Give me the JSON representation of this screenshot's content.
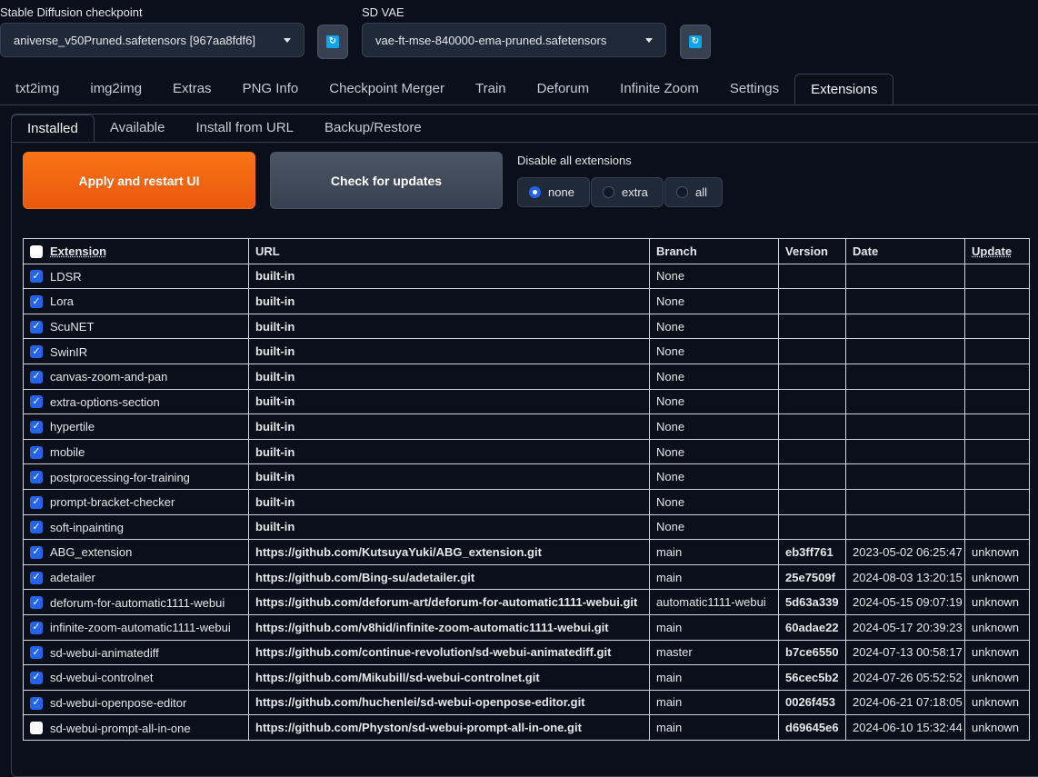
{
  "checkpoint": {
    "label": "Stable Diffusion checkpoint",
    "value": "aniverse_v50Pruned.safetensors [967aa8fdf6]"
  },
  "vae": {
    "label": "SD VAE",
    "value": "vae-ft-mse-840000-ema-pruned.safetensors"
  },
  "main_tabs": [
    "txt2img",
    "img2img",
    "Extras",
    "PNG Info",
    "Checkpoint Merger",
    "Train",
    "Deforum",
    "Infinite Zoom",
    "Settings",
    "Extensions"
  ],
  "sub_tabs": [
    "Installed",
    "Available",
    "Install from URL",
    "Backup/Restore"
  ],
  "buttons": {
    "apply": "Apply and restart UI",
    "check": "Check for updates"
  },
  "disable": {
    "label": "Disable all extensions",
    "options": [
      "none",
      "extra",
      "all"
    ],
    "selected": "none"
  },
  "table": {
    "headers": [
      "Extension",
      "URL",
      "Branch",
      "Version",
      "Date",
      "Update"
    ],
    "rows": [
      {
        "enabled": true,
        "name": "LDSR",
        "url": "built-in",
        "branch": "None",
        "version": "",
        "date": "",
        "update": ""
      },
      {
        "enabled": true,
        "name": "Lora",
        "url": "built-in",
        "branch": "None",
        "version": "",
        "date": "",
        "update": ""
      },
      {
        "enabled": true,
        "name": "ScuNET",
        "url": "built-in",
        "branch": "None",
        "version": "",
        "date": "",
        "update": ""
      },
      {
        "enabled": true,
        "name": "SwinIR",
        "url": "built-in",
        "branch": "None",
        "version": "",
        "date": "",
        "update": ""
      },
      {
        "enabled": true,
        "name": "canvas-zoom-and-pan",
        "url": "built-in",
        "branch": "None",
        "version": "",
        "date": "",
        "update": ""
      },
      {
        "enabled": true,
        "name": "extra-options-section",
        "url": "built-in",
        "branch": "None",
        "version": "",
        "date": "",
        "update": ""
      },
      {
        "enabled": true,
        "name": "hypertile",
        "url": "built-in",
        "branch": "None",
        "version": "",
        "date": "",
        "update": ""
      },
      {
        "enabled": true,
        "name": "mobile",
        "url": "built-in",
        "branch": "None",
        "version": "",
        "date": "",
        "update": ""
      },
      {
        "enabled": true,
        "name": "postprocessing-for-training",
        "url": "built-in",
        "branch": "None",
        "version": "",
        "date": "",
        "update": ""
      },
      {
        "enabled": true,
        "name": "prompt-bracket-checker",
        "url": "built-in",
        "branch": "None",
        "version": "",
        "date": "",
        "update": ""
      },
      {
        "enabled": true,
        "name": "soft-inpainting",
        "url": "built-in",
        "branch": "None",
        "version": "",
        "date": "",
        "update": ""
      },
      {
        "enabled": true,
        "name": "ABG_extension",
        "url": "https://github.com/KutsuyaYuki/ABG_extension.git",
        "branch": "main",
        "version": "eb3ff761",
        "date": "2023-05-02 06:25:47",
        "update": "unknown"
      },
      {
        "enabled": true,
        "name": "adetailer",
        "url": "https://github.com/Bing-su/adetailer.git",
        "branch": "main",
        "version": "25e7509f",
        "date": "2024-08-03 13:20:15",
        "update": "unknown"
      },
      {
        "enabled": true,
        "name": "deforum-for-automatic1111-webui",
        "url": "https://github.com/deforum-art/deforum-for-automatic1111-webui.git",
        "branch": "automatic1111-webui",
        "version": "5d63a339",
        "date": "2024-05-15 09:07:19",
        "update": "unknown"
      },
      {
        "enabled": true,
        "name": "infinite-zoom-automatic1111-webui",
        "url": "https://github.com/v8hid/infinite-zoom-automatic1111-webui.git",
        "branch": "main",
        "version": "60adae22",
        "date": "2024-05-17 20:39:23",
        "update": "unknown"
      },
      {
        "enabled": true,
        "name": "sd-webui-animatediff",
        "url": "https://github.com/continue-revolution/sd-webui-animatediff.git",
        "branch": "master",
        "version": "b7ce6550",
        "date": "2024-07-13 00:58:17",
        "update": "unknown"
      },
      {
        "enabled": true,
        "name": "sd-webui-controlnet",
        "url": "https://github.com/Mikubill/sd-webui-controlnet.git",
        "branch": "main",
        "version": "56cec5b2",
        "date": "2024-07-26 05:52:52",
        "update": "unknown"
      },
      {
        "enabled": true,
        "name": "sd-webui-openpose-editor",
        "url": "https://github.com/huchenlei/sd-webui-openpose-editor.git",
        "branch": "main",
        "version": "0026f453",
        "date": "2024-06-21 07:18:05",
        "update": "unknown"
      },
      {
        "enabled": false,
        "name": "sd-webui-prompt-all-in-one",
        "url": "https://github.com/Physton/sd-webui-prompt-all-in-one.git",
        "branch": "main",
        "version": "d69645e6",
        "date": "2024-06-10 15:32:44",
        "update": "unknown"
      }
    ]
  }
}
